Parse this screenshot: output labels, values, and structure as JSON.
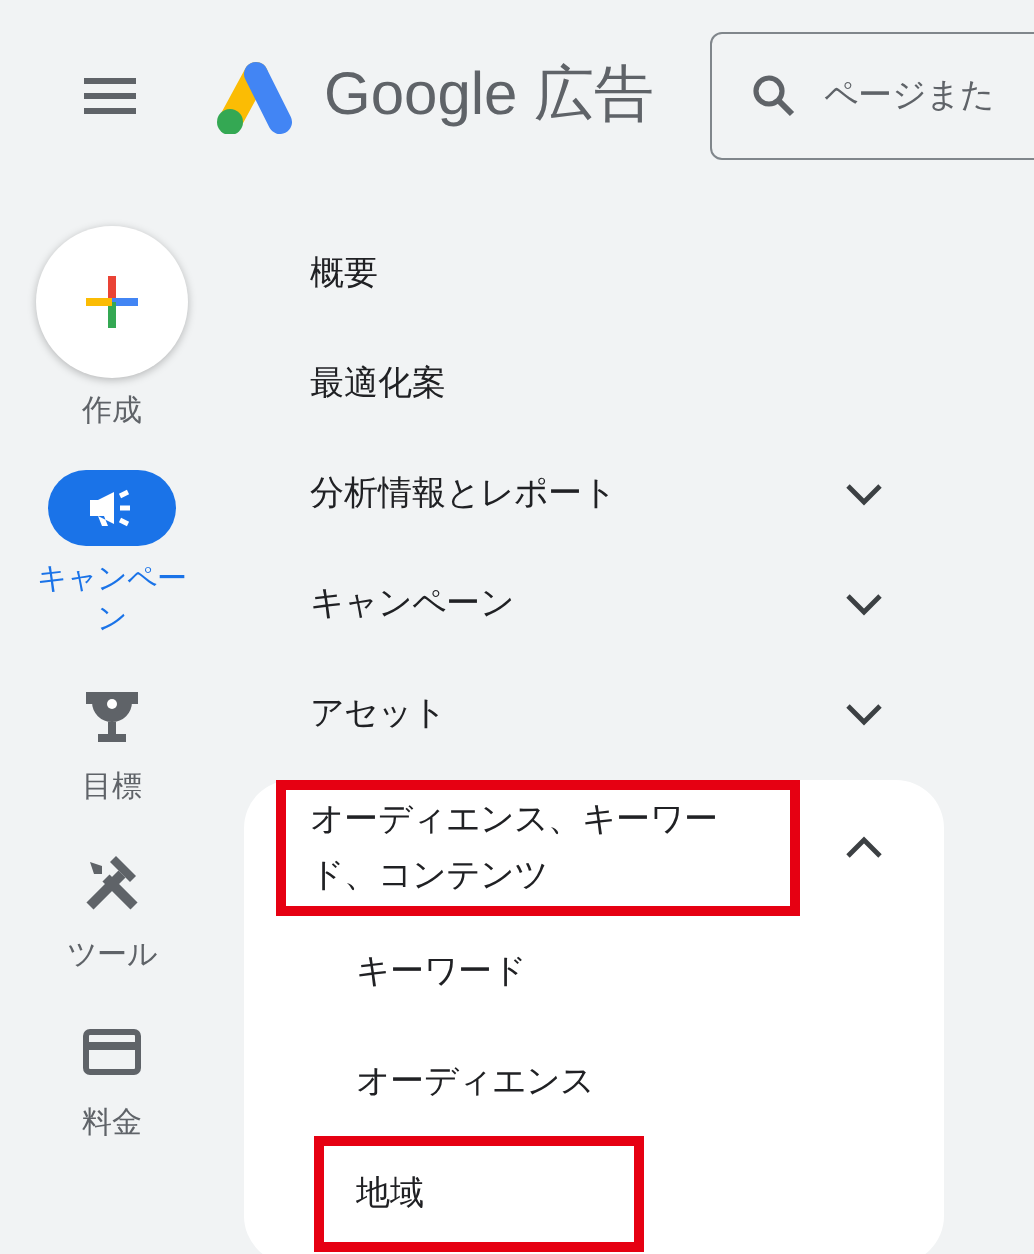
{
  "header": {
    "brand": "Google",
    "product": "広告",
    "search": {
      "placeholder": "ページまた"
    }
  },
  "rail": [
    {
      "kind": "create",
      "label": "作成",
      "selected": false
    },
    {
      "kind": "campaign",
      "label": "キャンペーン",
      "selected": true
    },
    {
      "kind": "goals",
      "label": "目標",
      "selected": false
    },
    {
      "kind": "tools",
      "label": "ツール",
      "selected": false
    },
    {
      "kind": "billing",
      "label": "料金",
      "selected": false
    }
  ],
  "menu": [
    {
      "kind": "link",
      "label": "概要",
      "highlighted": false
    },
    {
      "kind": "link",
      "label": "最適化案",
      "highlighted": false
    },
    {
      "kind": "group",
      "label": "分析情報とレポート",
      "expanded": false,
      "highlighted": false
    },
    {
      "kind": "group",
      "label": "キャンペーン",
      "expanded": false,
      "highlighted": false
    },
    {
      "kind": "group",
      "label": "アセット",
      "expanded": false,
      "highlighted": false
    },
    {
      "kind": "group",
      "label": "オーディエンス、キーワード、コンテンツ",
      "expanded": true,
      "highlighted": true,
      "children": [
        {
          "label": "キーワード",
          "highlighted": false
        },
        {
          "label": "オーディエンス",
          "highlighted": false
        },
        {
          "label": "地域",
          "highlighted": true
        }
      ]
    }
  ]
}
